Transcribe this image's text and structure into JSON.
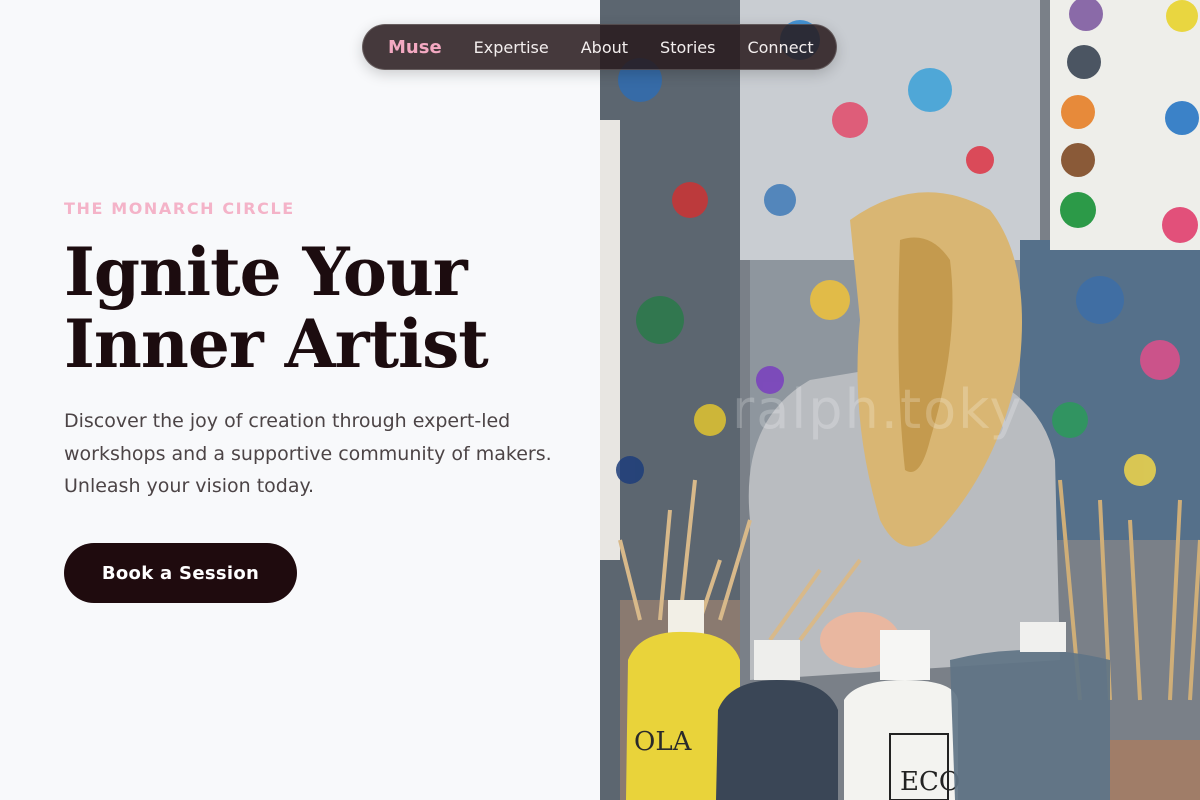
{
  "nav": {
    "brand": "Muse",
    "links": [
      {
        "label": "Expertise"
      },
      {
        "label": "About"
      },
      {
        "label": "Stories"
      },
      {
        "label": "Connect"
      }
    ]
  },
  "hero": {
    "eyebrow": "THE MONARCH CIRCLE",
    "headline_line1": "Ignite Your",
    "headline_line2": "Inner Artist",
    "description": "Discover the joy of creation through expert-led workshops and a supportive community of makers. Unleash your vision today.",
    "cta_label": "Book a Session"
  },
  "image": {
    "subject": "child-painting-in-art-studio",
    "watermark_text": "ralph.toky",
    "bottle_labels": [
      "OLA",
      "ECO"
    ]
  },
  "colors": {
    "page_background": "#f8f9fb",
    "brand_pink": "#f4a9c2",
    "eyebrow_pink": "#f4b3c8",
    "headline": "#1c0c0f",
    "body_text": "#4c4446",
    "cta_background": "#1f0b0e",
    "nav_background": "#281a1c"
  }
}
